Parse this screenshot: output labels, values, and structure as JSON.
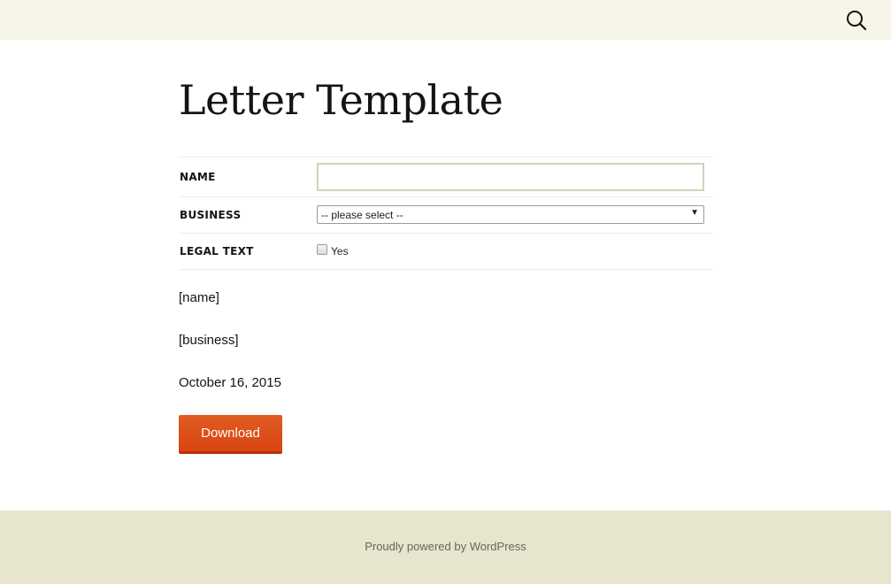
{
  "header": {
    "search_icon": "search-icon"
  },
  "page": {
    "title": "Letter Template"
  },
  "form": {
    "name_label": "NAME",
    "name_value": "",
    "name_placeholder": "",
    "business_label": "BUSINESS",
    "business_selected": "-- please select --",
    "legal_label": "LEGAL TEXT",
    "legal_option": "Yes",
    "legal_checked": false
  },
  "letter": {
    "name_placeholder": "[name]",
    "business_placeholder": "[business]",
    "date": "October 16, 2015"
  },
  "actions": {
    "download_label": "Download"
  },
  "footer": {
    "credit": "Proudly powered by WordPress"
  },
  "colors": {
    "topbar": "#f7f5e7",
    "footer": "#e8e5ce",
    "button": "#e05d22"
  }
}
